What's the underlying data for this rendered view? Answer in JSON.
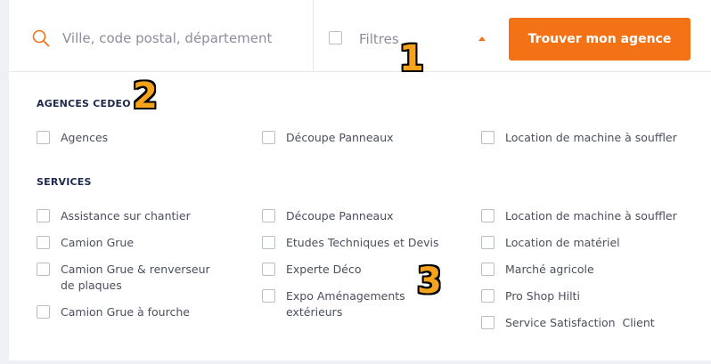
{
  "search": {
    "placeholder": "Ville, code postal, département",
    "value": ""
  },
  "filter": {
    "label": "Filtres"
  },
  "submit_label": "Trouver mon agence",
  "agences": {
    "title": "AGENCES CEDEO",
    "options": [
      "Agences",
      "Découpe Panneaux",
      "Location de machine à souffler"
    ]
  },
  "services": {
    "title": "SERVICES",
    "col1": [
      "Assistance sur chantier",
      "Camion Grue",
      "Camion Grue & renverseur de plaques",
      "Camion Grue à fourche"
    ],
    "col2": [
      "Découpe Panneaux",
      "Etudes Techniques et Devis",
      "Experte Déco",
      "Expo Aménagements extérieurs"
    ],
    "col3": [
      "Location de machine à souffler",
      "Location de matériel",
      "Marché agricole",
      "Pro Shop Hilti",
      "Service Satisfaction  Client"
    ]
  },
  "callouts": [
    "1",
    "2",
    "3"
  ],
  "colors": {
    "accent": "#f47216",
    "heading": "#1e2a4a",
    "callout": "#f7a21b"
  }
}
